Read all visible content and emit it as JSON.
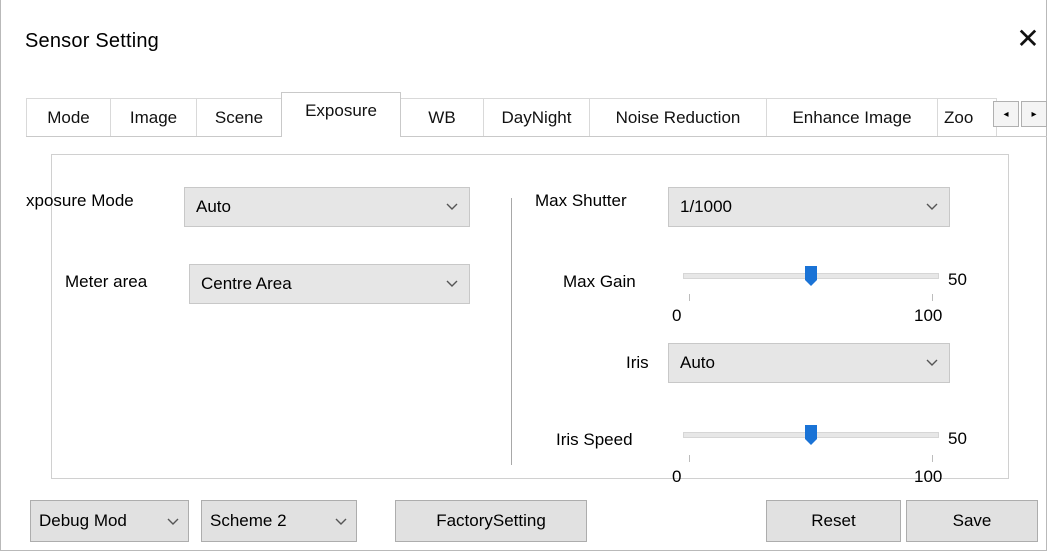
{
  "window": {
    "title": "Sensor Setting",
    "close_glyph": "✕"
  },
  "tabs": [
    {
      "label": "Mode"
    },
    {
      "label": "Image"
    },
    {
      "label": "Scene"
    },
    {
      "label": "Exposure",
      "active": true
    },
    {
      "label": "WB"
    },
    {
      "label": "DayNight"
    },
    {
      "label": "Noise Reduction"
    },
    {
      "label": "Enhance Image"
    },
    {
      "label": "Zoo"
    }
  ],
  "tab_scroll": {
    "left_glyph": "◂",
    "right_glyph": "▸"
  },
  "exposure": {
    "exposure_mode_label": "xposure Mode",
    "exposure_mode_value": "Auto",
    "meter_area_label": "Meter area",
    "meter_area_value": "Centre Area",
    "max_shutter_label": "Max Shutter",
    "max_shutter_value": "1/1000",
    "max_gain_label": "Max Gain",
    "max_gain_value": "50",
    "max_gain_min": "0",
    "max_gain_max": "100",
    "iris_label": "Iris",
    "iris_value": "Auto",
    "iris_speed_label": "Iris Speed",
    "iris_speed_value": "50",
    "iris_speed_min": "0",
    "iris_speed_max": "100"
  },
  "footer": {
    "debug_mode_value": "Debug Mod",
    "scheme_value": "Scheme 2",
    "factory_setting_label": "FactorySetting",
    "reset_label": "Reset",
    "save_label": "Save"
  },
  "colors": {
    "slider_thumb": "#1a73d6",
    "combo_bg": "#e6e6e6",
    "button_bg": "#e1e1e1"
  }
}
